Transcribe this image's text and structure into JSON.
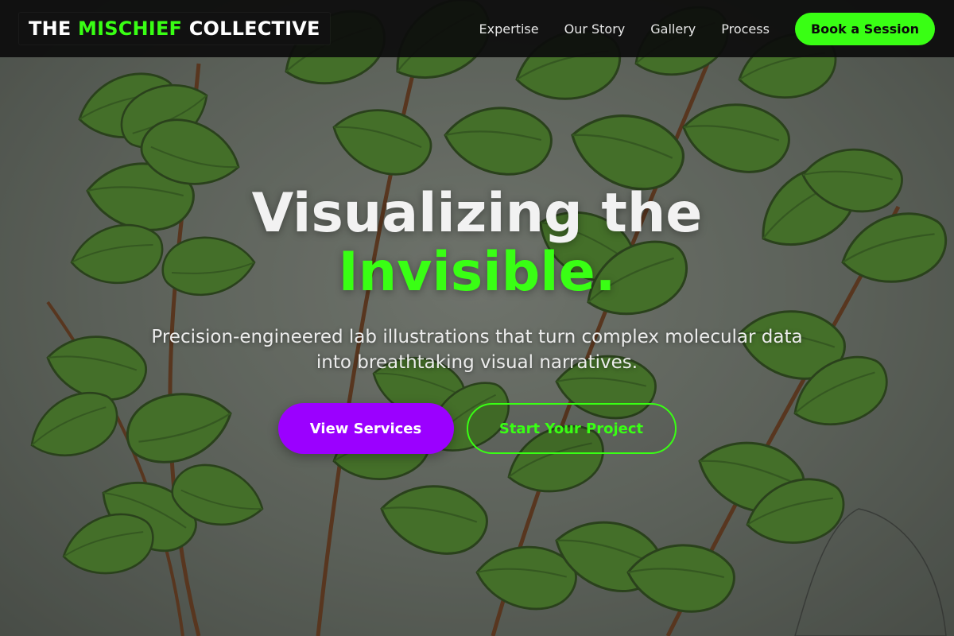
{
  "brand": {
    "prefix": "THE ",
    "highlight": "MISCHIEF",
    "suffix": " COLLECTIVE"
  },
  "nav": {
    "links": [
      "Expertise",
      "Our Story",
      "Gallery",
      "Process"
    ],
    "cta_label": "Book a Session"
  },
  "hero": {
    "headline_line1": "Visualizing the",
    "headline_line2": "Invisible.",
    "subheadline": "Precision-engineered lab illustrations that turn complex molecular data into breathtaking visual narratives.",
    "primary_button": "View Services",
    "secondary_button": "Start Your Project",
    "background_image": "fern-leaf-botanical-illustration"
  },
  "colors": {
    "accent": "#39ff14",
    "primary_button": "#9b00ff",
    "nav_background": "#0c0c0c",
    "text": "#f2f2f2"
  }
}
